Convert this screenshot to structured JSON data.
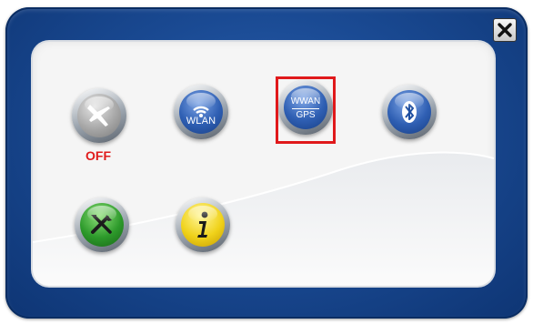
{
  "airplane": {
    "status": "OFF"
  },
  "wlan": {
    "label": "WLAN"
  },
  "wwan_gps": {
    "top": "WWAN",
    "bottom": "GPS"
  },
  "colors": {
    "frame": "#1a4a93",
    "off_text": "#e01b1b",
    "selection": "#e0191b"
  },
  "icons": [
    "close-icon",
    "airplane-icon",
    "wlan-icon",
    "wwan-gps-icon",
    "bluetooth-icon",
    "tools-icon",
    "info-icon"
  ]
}
